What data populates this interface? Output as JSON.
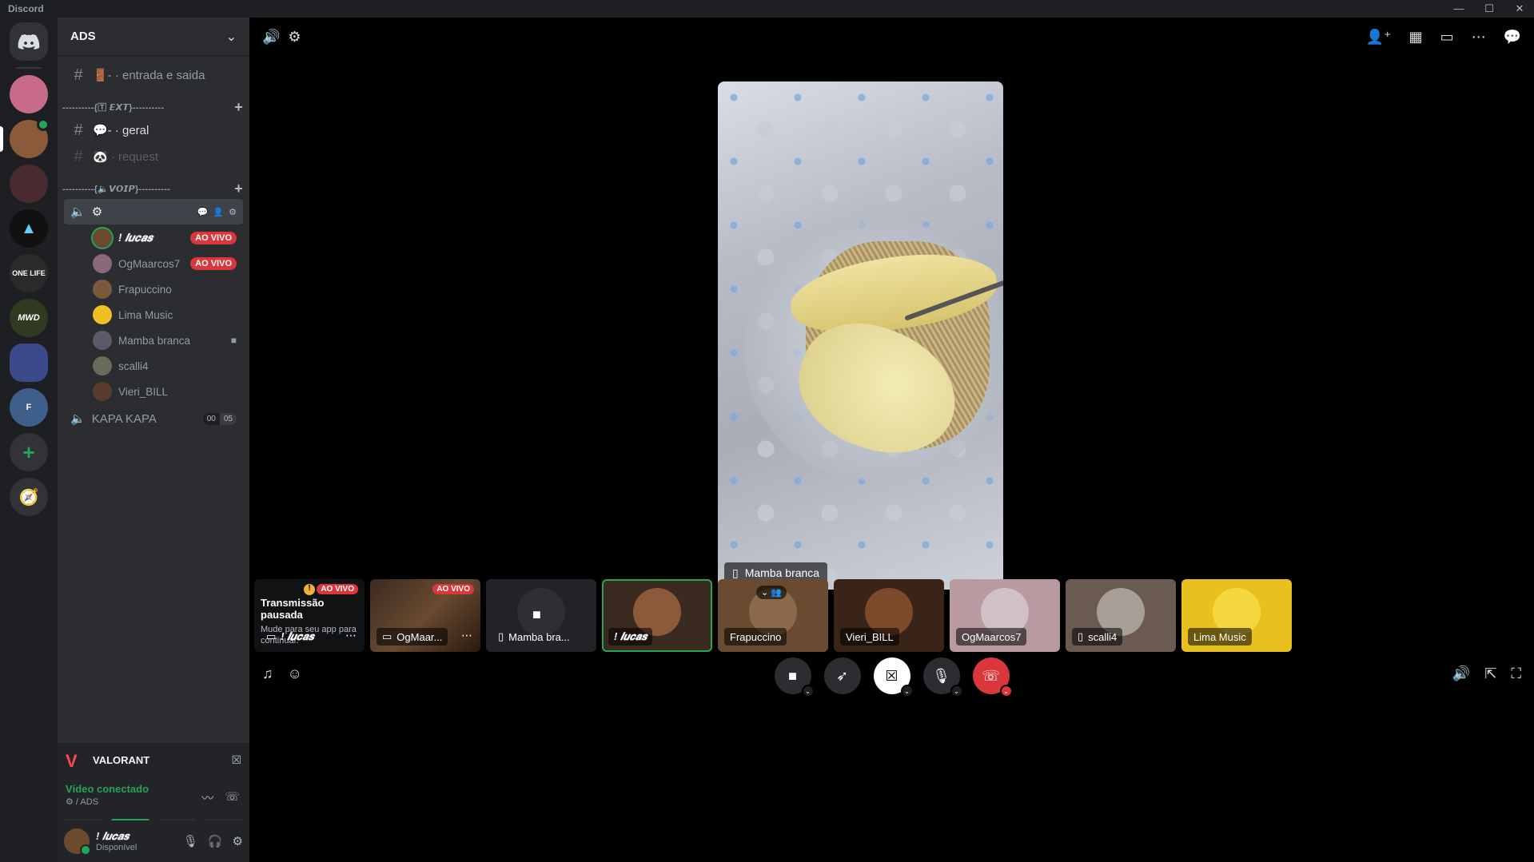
{
  "window": {
    "app_title": "Discord",
    "controls": [
      "—",
      "☐",
      "✕"
    ]
  },
  "guilds": [
    {
      "label": "DC",
      "color": "#313338"
    },
    {
      "label": "",
      "color": "#c86b8a"
    },
    {
      "label": "",
      "color": "#8a5a3a"
    },
    {
      "label": "",
      "color": "#4a2a30"
    },
    {
      "label": "▲",
      "color": "#111111"
    },
    {
      "label": "ONE LIFE",
      "color": "#2a2a2a"
    },
    {
      "label": "MWD",
      "color": "#303a20"
    },
    {
      "label": "",
      "color": "#3a4a8a"
    },
    {
      "label": "F",
      "color": "#3f5f8a"
    }
  ],
  "server": {
    "name": "ADS",
    "chevron": "⌄"
  },
  "channels": {
    "entrada": {
      "icon": "#",
      "label": "🚪- · entrada  e  saida"
    },
    "text_category": "----------{🅃 𝙀𝙓𝙏}----------",
    "geral": {
      "icon": "#",
      "label": "💬- · geral"
    },
    "request": {
      "icon": "#",
      "label": "🐼 · request"
    },
    "voip_category": "----------{🔈𝙑𝙊𝙄𝙋}----------",
    "voice_channel_label": "⚙︎"
  },
  "voice_users": [
    {
      "name": "! 𝒍𝒖𝒄𝒂𝒔",
      "live": "AO VIVO",
      "color": "#6b4a2e",
      "me": true
    },
    {
      "name": "OgMaarcos7",
      "live": "AO VIVO",
      "color": "#8a6a7a"
    },
    {
      "name": "Frapuccino",
      "color": "#7a5a3a"
    },
    {
      "name": "Lima Music",
      "color": "#f0c020"
    },
    {
      "name": "Mamba branca",
      "color": "#5a5a6a",
      "cam": "■"
    },
    {
      "name": "scalli4",
      "color": "#6a6a5a"
    },
    {
      "name": "Vieri_BILL",
      "color": "#5a3a2a"
    }
  ],
  "kapa": {
    "label": "KAPA KAPA",
    "count_a": "00",
    "count_b": "05"
  },
  "activity": {
    "game": "VALORANT"
  },
  "voice_conn": {
    "status": "Vídeo conectado",
    "sub": "⚙︎ / ADS"
  },
  "user": {
    "name": "! 𝒍𝒖𝒄𝒂𝒔",
    "status": "Disponível"
  },
  "main_video": {
    "name": "Mamba branca"
  },
  "tiles": {
    "paused": {
      "live": "AO VIVO",
      "title": "Transmissão pausada",
      "desc": "Mude para seu app para continuar.",
      "name": "! 𝒍𝒖𝒄𝒂𝒔"
    },
    "ogmaar": {
      "live": "AO VIVO",
      "name": "OgMaar..."
    },
    "mamba": {
      "name": "Mamba bra..."
    },
    "lucas": {
      "name": "! 𝒍𝒖𝒄𝒂𝒔"
    },
    "frapuccino": {
      "name": "Frapuccino"
    },
    "vieri": {
      "name": "Vieri_BILL"
    },
    "ogmaarcos7": {
      "name": "OgMaarcos7"
    },
    "scalli4": {
      "name": "scalli4"
    },
    "lima": {
      "name": "Lima Music"
    }
  }
}
